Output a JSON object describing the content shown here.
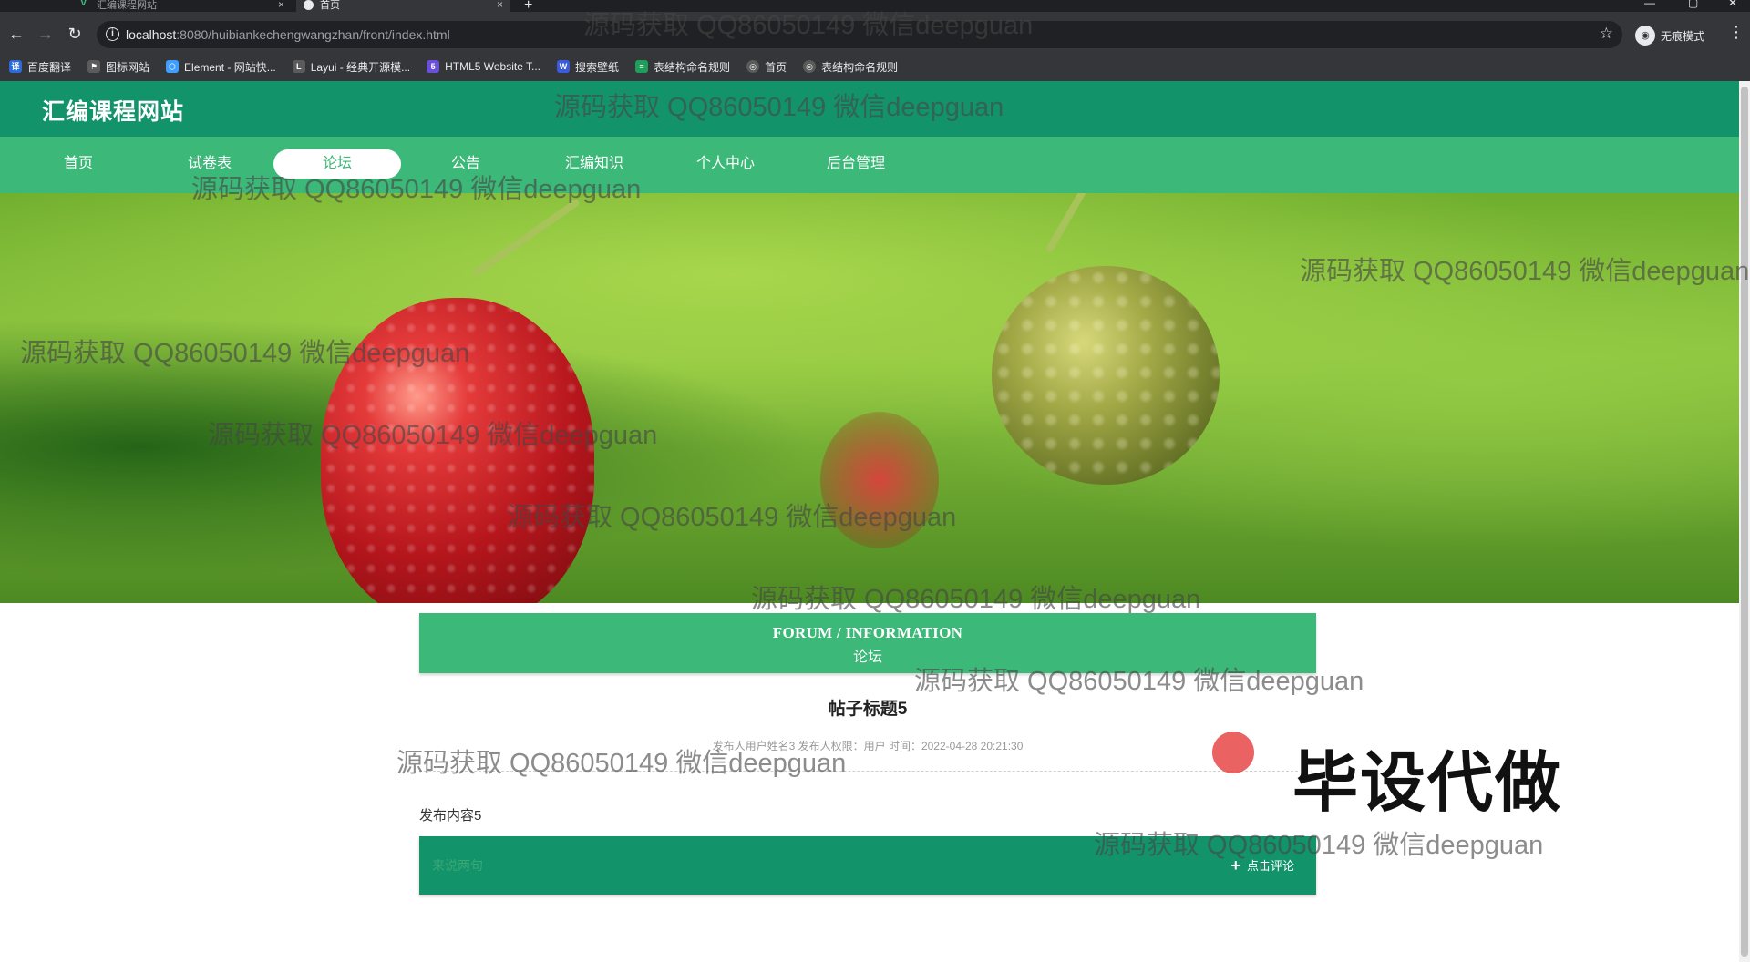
{
  "browser": {
    "tabs": [
      {
        "title": "汇编课程网站",
        "icon": "vue-icon",
        "active": false
      },
      {
        "title": "首页",
        "icon": "globe-icon",
        "active": true
      }
    ],
    "new_tab_symbol": "+",
    "close_symbol": "×",
    "url_host": "localhost",
    "url_rest": ":8080/huibiankechengwangzhan/front/index.html",
    "incognito_label": "无痕模式",
    "bookmarks": [
      {
        "label": "百度翻译",
        "icon": "translate-icon",
        "color": "#2f6bd8"
      },
      {
        "label": "图标网站",
        "icon": "flag-icon",
        "color": "#5b5b5b"
      },
      {
        "label": "Element - 网站快...",
        "icon": "hexagon-icon",
        "color": "#409eff"
      },
      {
        "label": "Layui - 经典开源模...",
        "icon": "layui-icon",
        "color": "#5b5b5b"
      },
      {
        "label": "HTML5 Website T...",
        "icon": "html5-icon",
        "color": "#6a4fd8"
      },
      {
        "label": "搜索壁纸",
        "icon": "wallpaper-icon",
        "color": "#3b5bdb"
      },
      {
        "label": "表结构命名规则",
        "icon": "sheet-icon",
        "color": "#1e9e5a"
      },
      {
        "label": "首页",
        "icon": "globe-icon",
        "color": "#5b5b5b"
      },
      {
        "label": "表结构命名规则",
        "icon": "globe-icon",
        "color": "#5b5b5b"
      }
    ]
  },
  "site": {
    "title": "汇编课程网站",
    "nav": [
      "首页",
      "试卷表",
      "论坛",
      "公告",
      "汇编知识",
      "个人中心",
      "后台管理"
    ],
    "active_nav": "论坛",
    "colors": {
      "header": "#13936a",
      "nav": "#3cb878",
      "accent": "#3cb878"
    }
  },
  "banner": {
    "image": "raspberries-photo",
    "slides": 3,
    "current_slide": 1
  },
  "section": {
    "en": "FORUM / INFORMATION",
    "zh": "论坛"
  },
  "post": {
    "title": "帖子标题5",
    "meta": "发布人用户姓名3   发布人权限：用户   时间：2022-04-28 20:21:30",
    "content": "发布内容5"
  },
  "comment": {
    "placeholder": "来说两句",
    "button_label": "点击评论",
    "button_icon": "plus-icon"
  },
  "overlays": {
    "watermark": "源码获取 QQ86050149 微信deepguan",
    "stamp": "毕设代做"
  }
}
